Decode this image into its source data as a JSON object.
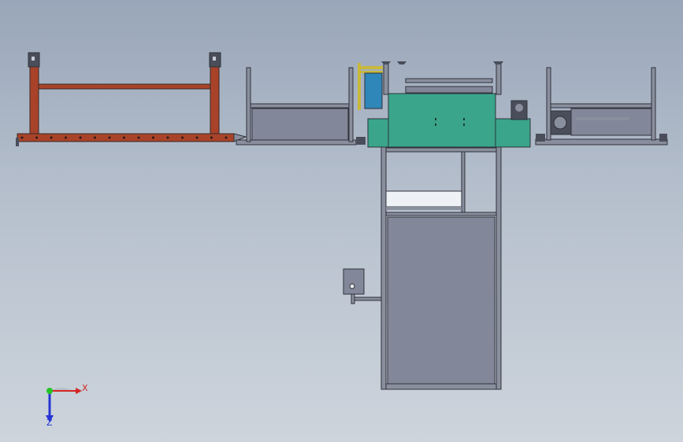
{
  "viewport": {
    "background_top": "#99a6b9",
    "background_bottom": "#cdd4dc"
  },
  "model": {
    "colors": {
      "rust_frame": "#a8432a",
      "frame_outline": "#3a2a25",
      "steel": "#8a8f9e",
      "steel_dark": "#4a4e5a",
      "panel_fill": "#828899",
      "teal_cover": "#3aa58a",
      "blue_plate": "#2f86b8",
      "yellow_guard": "#c9b83a",
      "bin_highlight": "#eef2f7"
    },
    "components": [
      "rust-conveyor-frame",
      "infeed-conveyor",
      "main-machine",
      "outfeed-conveyor",
      "control-box"
    ]
  },
  "triad": {
    "x_label": "X",
    "z_label": "Z",
    "x_color": "#d42525",
    "y_color": "#25c425",
    "z_color": "#2535d4"
  }
}
